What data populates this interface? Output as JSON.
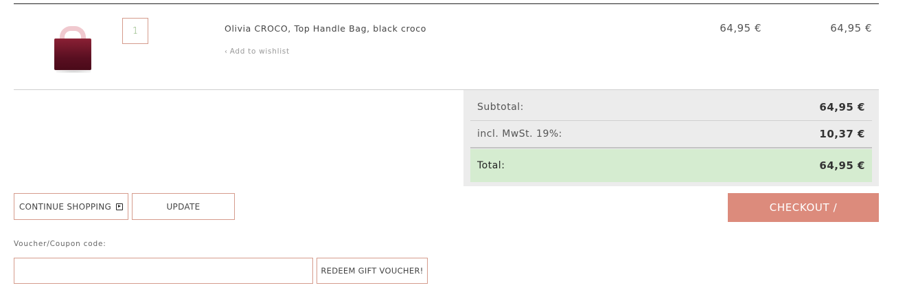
{
  "cart": {
    "item": {
      "quantity": "1",
      "name": "Olivia CROCO, Top Handle Bag, black croco",
      "wishlist_label": "Add to wishlist",
      "wishlist_chevron": "‹",
      "unit_price": "64,95 €",
      "line_total": "64,95 €",
      "image_icon": "handbag-image"
    }
  },
  "totals": {
    "subtotal_label": "Subtotal:",
    "subtotal_value": "64,95 €",
    "tax_label": "incl. MwSt. 19%:",
    "tax_value": "10,37 €",
    "total_label": "Total:",
    "total_value": "64,95 €",
    "total_row_color": "#d5ecd0"
  },
  "actions": {
    "continue_label": "CONTINUE SHOPPING",
    "continue_icon": "play-square-icon",
    "update_label": "UPDATE",
    "checkout_label": "CHECKOUT /",
    "checkout_color": "#dc8b7c"
  },
  "voucher": {
    "label": "Voucher/Coupon code:",
    "value": "",
    "placeholder": "",
    "redeem_label": "REDEEM GIFT VOUCHER!"
  },
  "colors": {
    "accent_border": "#d59b8c",
    "panel_bg": "#ececec"
  }
}
